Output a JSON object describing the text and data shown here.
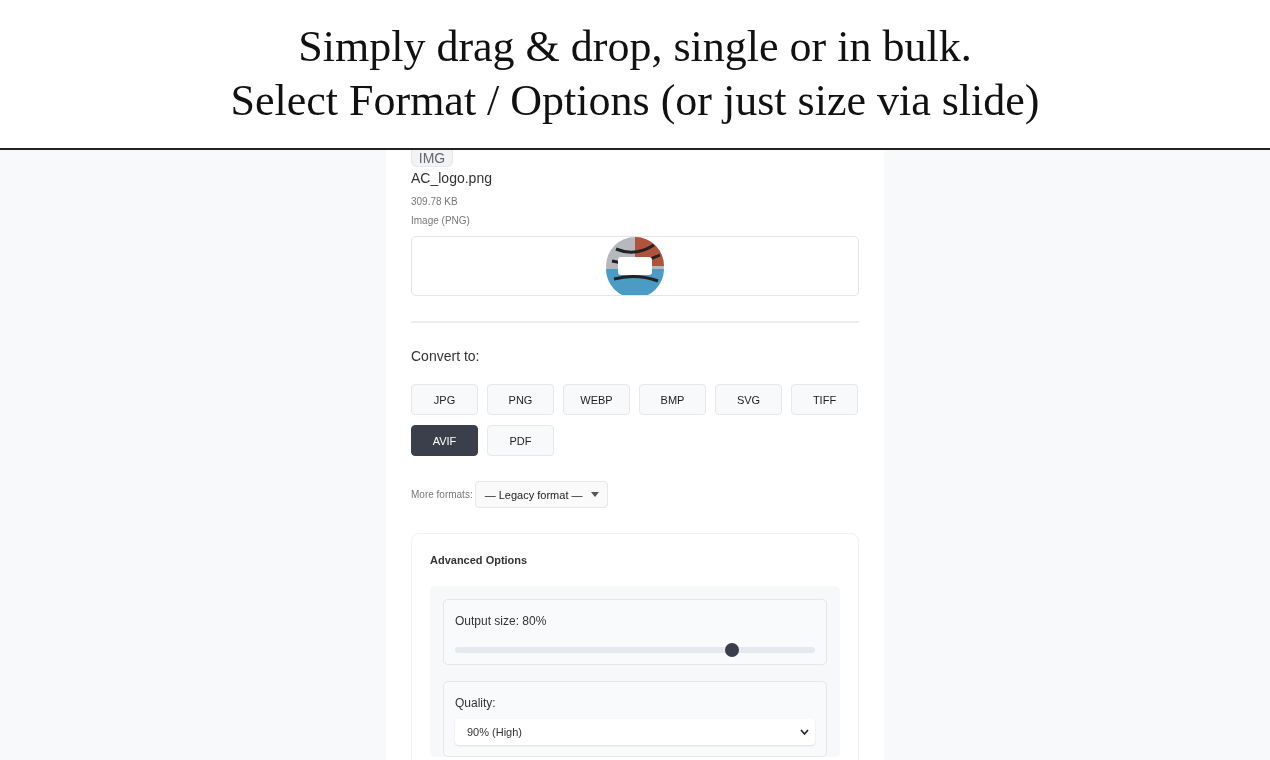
{
  "caption": {
    "lines": [
      "Simply drag & drop, single or in bulk.",
      "Select Format / Options (or just size via slide)"
    ]
  },
  "file": {
    "icon_label": "IMG",
    "name": "AC_logo.png",
    "size": "309.78 KB",
    "type": "Image (PNG)"
  },
  "convert": {
    "label": "Convert to:",
    "formats": [
      {
        "label": "JPG",
        "selected": false
      },
      {
        "label": "PNG",
        "selected": false
      },
      {
        "label": "WEBP",
        "selected": false
      },
      {
        "label": "BMP",
        "selected": false
      },
      {
        "label": "SVG",
        "selected": false
      },
      {
        "label": "TIFF",
        "selected": false
      },
      {
        "label": "AVIF",
        "selected": true
      },
      {
        "label": "PDF",
        "selected": false
      }
    ],
    "more_formats": {
      "label": "More formats:",
      "value": "— Legacy format —"
    }
  },
  "advanced": {
    "title": "Advanced Options",
    "output_size": {
      "label": "Output size: 80%",
      "level": 0.77
    },
    "quality": {
      "label": "Quality:",
      "value": "90% (High)"
    }
  }
}
